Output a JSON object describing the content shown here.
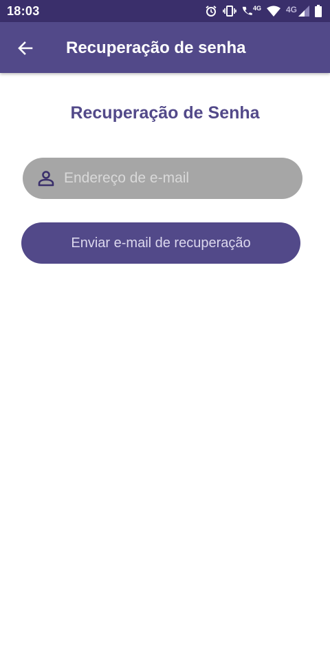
{
  "status_bar": {
    "time": "18:03",
    "icons": [
      "alarm-icon",
      "vibrate-icon",
      "wifi-call-icon",
      "wifi-icon",
      "cellular-signal-icon",
      "battery-icon"
    ],
    "call_network_label": "4G",
    "network_label": "4G"
  },
  "app_bar": {
    "back_icon": "arrow-left-icon",
    "title": "Recuperação de senha"
  },
  "main": {
    "heading": "Recuperação de Senha",
    "email_field": {
      "icon": "person-icon",
      "value": "",
      "placeholder": "Endereço de e-mail"
    },
    "submit_label": "Enviar e-mail de recuperação"
  },
  "colors": {
    "primary": "#524989",
    "status_bar": "#3a2f6b",
    "input_background": "#a6a6a6",
    "background": "#ffffff"
  }
}
